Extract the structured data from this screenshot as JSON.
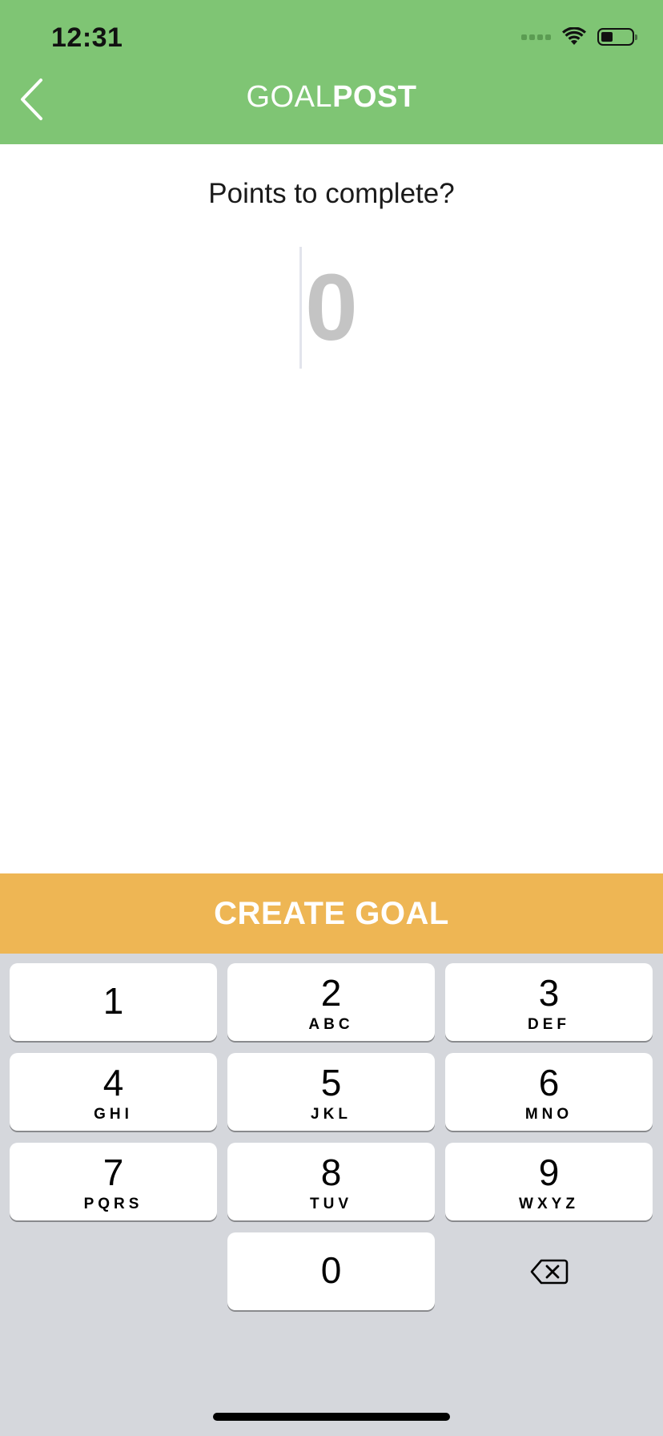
{
  "status_bar": {
    "time": "12:31"
  },
  "header": {
    "title_light": "GOAL",
    "title_bold": "POST",
    "background_color": "#7fc574"
  },
  "icons": {
    "back": "chevron-left-icon",
    "wifi": "wifi-icon",
    "battery": "battery-icon",
    "signal": "cellular-signal-icon",
    "delete": "backspace-icon"
  },
  "form": {
    "prompt": "Points to complete?",
    "points_placeholder": "0"
  },
  "actions": {
    "create_goal_label": "CREATE GOAL",
    "create_goal_color": "#eeb654"
  },
  "keypad": {
    "keys": [
      {
        "digit": "1",
        "letters": ""
      },
      {
        "digit": "2",
        "letters": "ABC"
      },
      {
        "digit": "3",
        "letters": "DEF"
      },
      {
        "digit": "4",
        "letters": "GHI"
      },
      {
        "digit": "5",
        "letters": "JKL"
      },
      {
        "digit": "6",
        "letters": "MNO"
      },
      {
        "digit": "7",
        "letters": "PQRS"
      },
      {
        "digit": "8",
        "letters": "TUV"
      },
      {
        "digit": "9",
        "letters": "WXYZ"
      },
      {
        "digit": "0",
        "letters": ""
      }
    ]
  }
}
